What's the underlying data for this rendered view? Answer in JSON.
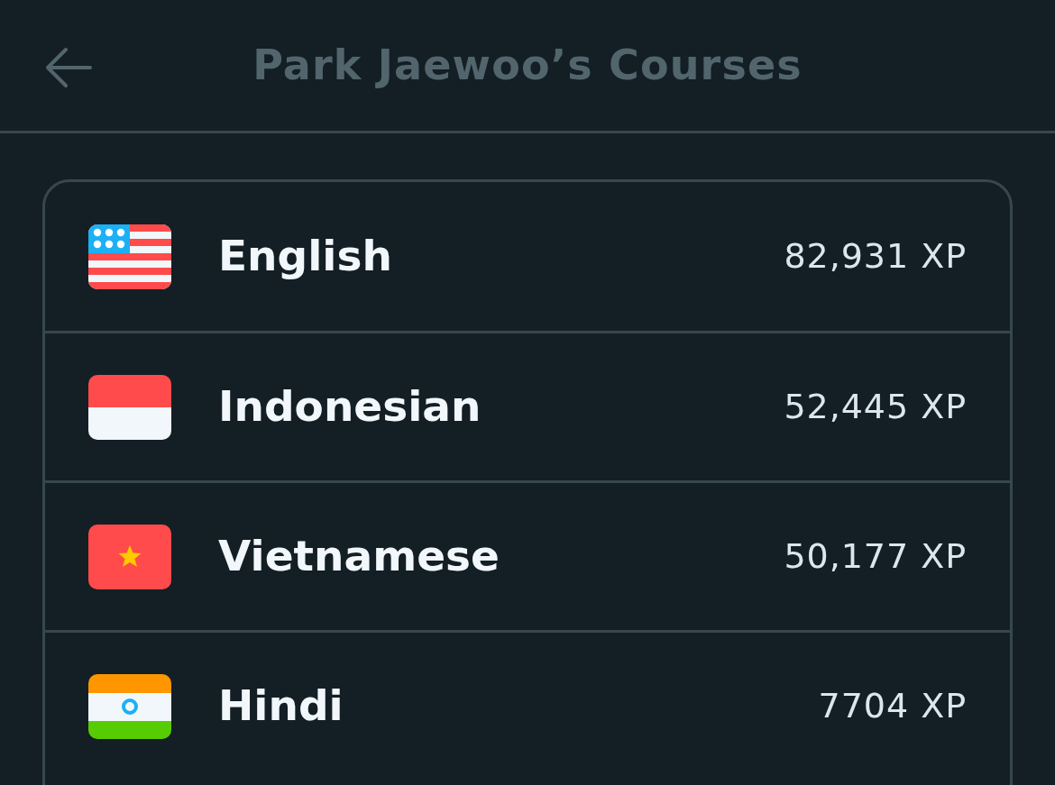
{
  "header": {
    "title": "Park Jaewoo’s Courses"
  },
  "courses": [
    {
      "kind": "us",
      "name": "English",
      "xp": "82,931 XP"
    },
    {
      "kind": "id",
      "name": "Indonesian",
      "xp": "52,445 XP"
    },
    {
      "kind": "vn",
      "name": "Vietnamese",
      "xp": "50,177 XP"
    },
    {
      "kind": "in",
      "name": "Hindi",
      "xp": "7704 XP"
    }
  ]
}
